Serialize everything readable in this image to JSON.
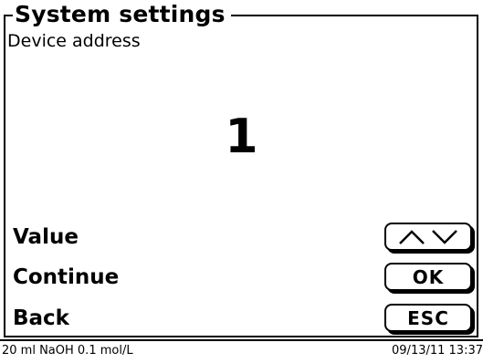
{
  "screen": {
    "title": "System settings",
    "subtitle": "Device address",
    "value": "1"
  },
  "rows": [
    {
      "label": "Value",
      "key": "up-down-arrows"
    },
    {
      "label": "Continue",
      "key": "OK"
    },
    {
      "label": "Back",
      "key": "ESC"
    }
  ],
  "status": {
    "left": "20 ml NaOH 0.1 mol/L",
    "right": "09/13/11 13:37"
  }
}
